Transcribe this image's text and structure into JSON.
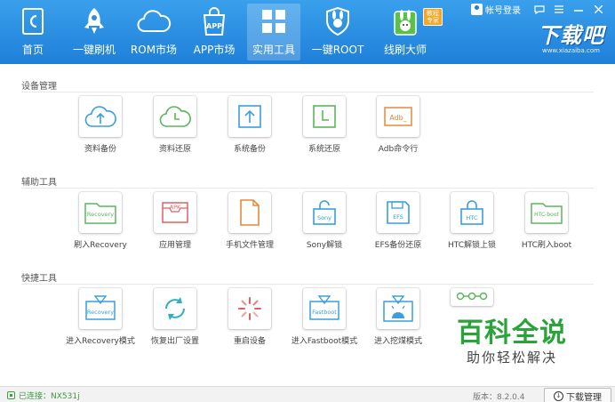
{
  "nav": {
    "items": [
      {
        "label": "首页"
      },
      {
        "label": "一键刷机"
      },
      {
        "label": "ROM市场"
      },
      {
        "label": "APP市场"
      },
      {
        "label": "实用工具"
      },
      {
        "label": "一键ROOT"
      },
      {
        "label": "线刷大师"
      }
    ],
    "hot_badge": "教程专家",
    "app_icon_text": "APP",
    "active": "实用工具"
  },
  "header_right": {
    "login": "帐号登录",
    "logo_big": "下载吧",
    "logo_small": "www.xiazaiba.com"
  },
  "sections": {
    "device": {
      "title": "设备管理",
      "tools": [
        {
          "label": "资料备份",
          "icon": "cloud-upload-icon"
        },
        {
          "label": "资料还原",
          "icon": "cloud-clock-icon"
        },
        {
          "label": "系统备份",
          "icon": "upload-box-icon"
        },
        {
          "label": "系统还原",
          "icon": "clock-box-icon"
        },
        {
          "label": "Adb命令行",
          "icon": "adb-terminal-icon",
          "icon_text": "Adb_"
        }
      ]
    },
    "assist": {
      "title": "辅助工具",
      "tools": [
        {
          "label": "刷入Recovery",
          "icon": "recovery-folder-icon",
          "icon_text": "Recovery"
        },
        {
          "label": "应用管理",
          "icon": "apk-box-icon",
          "icon_text": "APK"
        },
        {
          "label": "手机文件管理",
          "icon": "file-icon"
        },
        {
          "label": "Sony解锁",
          "icon": "sony-unlock-icon",
          "icon_text": "Sony"
        },
        {
          "label": "EFS备份还原",
          "icon": "efs-floppy-icon",
          "icon_text": "EFS"
        },
        {
          "label": "HTC解锁上锁",
          "icon": "htc-lock-icon",
          "icon_text": "HTC"
        },
        {
          "label": "HTC刷入boot",
          "icon": "htc-boot-folder-icon",
          "icon_text": "HTC-boot"
        }
      ]
    },
    "quick": {
      "title": "快捷工具",
      "tools": [
        {
          "label": "进入Recovery模式",
          "icon": "recovery-mode-icon",
          "icon_text": "Recovery"
        },
        {
          "label": "恢复出厂设置",
          "icon": "factory-reset-icon"
        },
        {
          "label": "重启设备",
          "icon": "reboot-spinner-icon"
        },
        {
          "label": "进入Fastboot模式",
          "icon": "fastboot-mode-icon",
          "icon_text": "Fastboot"
        },
        {
          "label": "进入挖煤模式",
          "icon": "android-download-mode-icon"
        },
        {
          "label": "",
          "icon": "chain-nodes-icon"
        }
      ]
    }
  },
  "footer": {
    "status": "已连接：NX531j",
    "version": "版本：8.2.0.4",
    "download_button": "下载管理"
  },
  "watermark": {
    "line1": "百科全说",
    "line2": "助你轻松解决"
  },
  "colors": {
    "header": "#1e7fd8",
    "blue_icon": "#3a9fdc",
    "green_icon": "#5bb55b",
    "orange_icon": "#e28a3c",
    "red_icon": "#e06060",
    "watermark_green": "#2aa33a"
  }
}
